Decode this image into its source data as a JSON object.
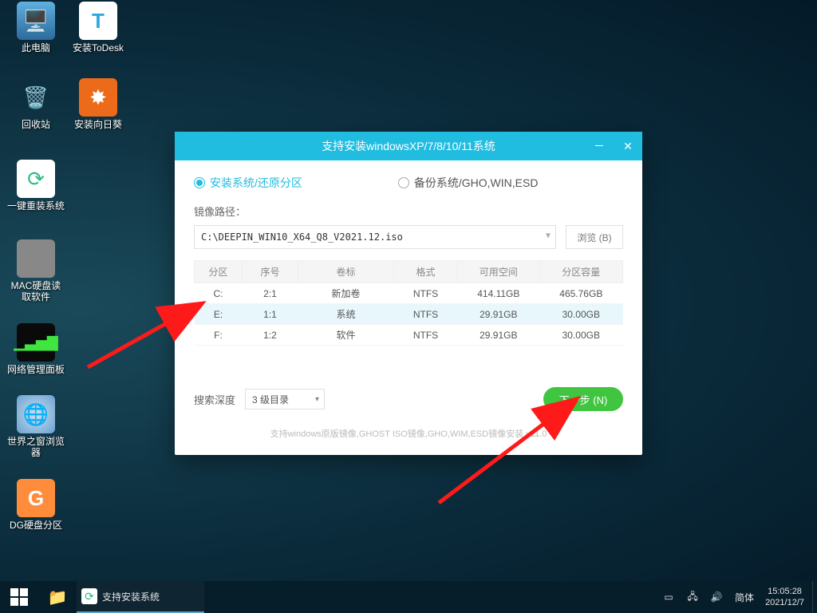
{
  "desktop_icons": [
    {
      "label": "此电脑"
    },
    {
      "label": "安装ToDesk"
    },
    {
      "label": "回收站"
    },
    {
      "label": "安装向日葵"
    },
    {
      "label": "一键重装系统"
    },
    {
      "label": "MAC硬盘读取软件"
    },
    {
      "label": "网络管理面板"
    },
    {
      "label": "世界之窗浏览器"
    },
    {
      "label": "DG硬盘分区"
    }
  ],
  "window": {
    "title": "支持安装windowsXP/7/8/10/11系统",
    "radios": {
      "install": "安装系统/还原分区",
      "backup": "备份系统/GHO,WIN,ESD"
    },
    "path_label": "镜像路径：",
    "path_value": "C:\\DEEPIN_WIN10_X64_Q8_V2021.12.iso",
    "browse": "浏览 (B)",
    "columns": [
      "分区",
      "序号",
      "卷标",
      "格式",
      "可用空间",
      "分区容量"
    ],
    "rows": [
      {
        "drive": "C:",
        "index": "2:1",
        "label": "新加卷",
        "fs": "NTFS",
        "free": "414.11GB",
        "total": "465.76GB",
        "selected": false
      },
      {
        "drive": "E:",
        "index": "1:1",
        "label": "系统",
        "fs": "NTFS",
        "free": "29.91GB",
        "total": "30.00GB",
        "selected": true
      },
      {
        "drive": "F:",
        "index": "1:2",
        "label": "软件",
        "fs": "NTFS",
        "free": "29.91GB",
        "total": "30.00GB",
        "selected": false
      }
    ],
    "depth_label": "搜索深度",
    "depth_value": "3 级目录",
    "next": "下一步 (N)",
    "footnote": "支持windows原版镜像,GHOST ISO镜像,GHO,WIM,ESD镜像安装 v11.0"
  },
  "taskbar": {
    "task_label": "支持安装系统",
    "ime": "简体",
    "time": "15:05:28",
    "date": "2021/12/7"
  }
}
